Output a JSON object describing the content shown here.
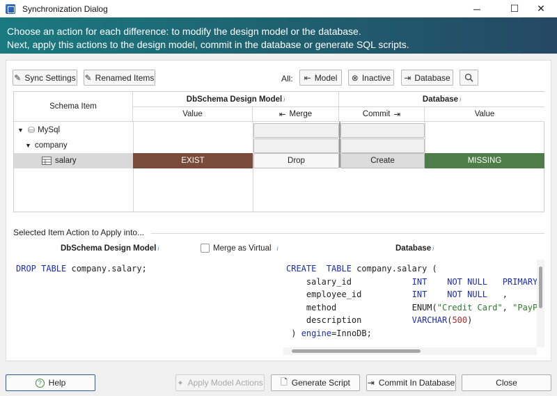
{
  "window": {
    "title": "Synchronization Dialog",
    "minimize": "─",
    "maximize": "☐",
    "close": "✕"
  },
  "banner": {
    "line1": "Choose an action for each difference: to modify the design model or the database.",
    "line2": "Next, apply this actions to the design model, commit in the database or generate SQL scripts."
  },
  "toolbar": {
    "sync_settings": "Sync Settings",
    "renamed_items": "Renamed Items",
    "all_label": "All:",
    "model": "Model",
    "inactive": "Inactive",
    "database": "Database"
  },
  "grid": {
    "schema_item_header": "Schema Item",
    "design_model_header": "DbSchema Design Model",
    "database_header": "Database",
    "value_header": "Value",
    "merge_header": "Merge",
    "commit_header": "Commit",
    "db_value_header": "Value",
    "rows": [
      {
        "name": "MySql",
        "model_value": "",
        "merge": "",
        "commit": "",
        "db_value": ""
      },
      {
        "name": "company",
        "model_value": "",
        "merge": "",
        "commit": "",
        "db_value": ""
      },
      {
        "name": "salary",
        "model_value": "EXIST",
        "merge": "Drop",
        "commit": "Create",
        "db_value": "MISSING"
      }
    ]
  },
  "selected": {
    "section_label": "Selected Item Action to Apply into...",
    "left_header": "DbSchema Design Model",
    "merge_virtual": "Merge as Virtual",
    "right_header": "Database"
  },
  "sql": {
    "left": "DROP TABLE company.salary;",
    "right": "CREATE  TABLE company.salary ( salary_id INT NOT NULL PRIMARY employee_id INT NOT NULL , method ENUM('Credit Card', 'PayPa description VARCHAR(500) ) engine=InnoDB;"
  },
  "footer": {
    "help": "Help",
    "apply": "Apply Model Actions",
    "generate": "Generate Script",
    "commit": "Commit In Database",
    "close": "Close"
  },
  "colors": {
    "exist": "#7a4a3a",
    "missing": "#4f7d4a",
    "banner_start": "#1a7a7f",
    "banner_end": "#254864"
  }
}
